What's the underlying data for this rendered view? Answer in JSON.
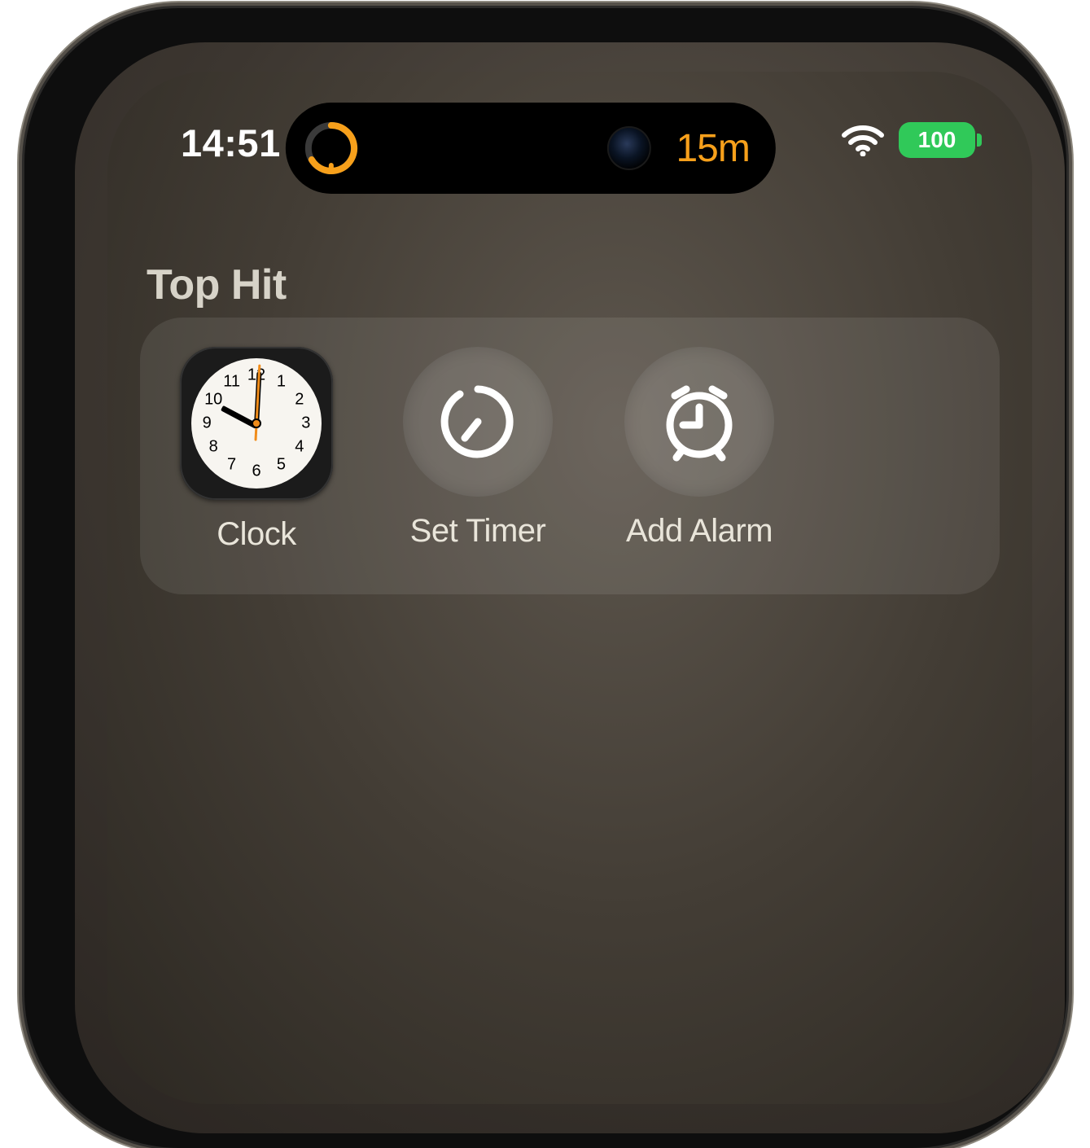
{
  "status_bar": {
    "time": "14:51",
    "battery_level": "100"
  },
  "dynamic_island": {
    "timer_remaining": "15m",
    "ring_color": "#f7a01b"
  },
  "search": {
    "section_title": "Top Hit",
    "results": [
      {
        "label": "Clock",
        "icon": "clock-app-icon"
      },
      {
        "label": "Set Timer",
        "icon": "timer-icon"
      },
      {
        "label": "Add Alarm",
        "icon": "alarm-icon"
      }
    ]
  },
  "clock_face": {
    "hour_angle_deg": -62,
    "minute_angle_deg": 3,
    "second_angle_deg": 3,
    "numbers": [
      "12",
      "1",
      "2",
      "3",
      "4",
      "5",
      "6",
      "7",
      "8",
      "9",
      "10",
      "11"
    ]
  },
  "colors": {
    "accent_orange": "#f7a01b",
    "battery_green": "#30c959"
  }
}
